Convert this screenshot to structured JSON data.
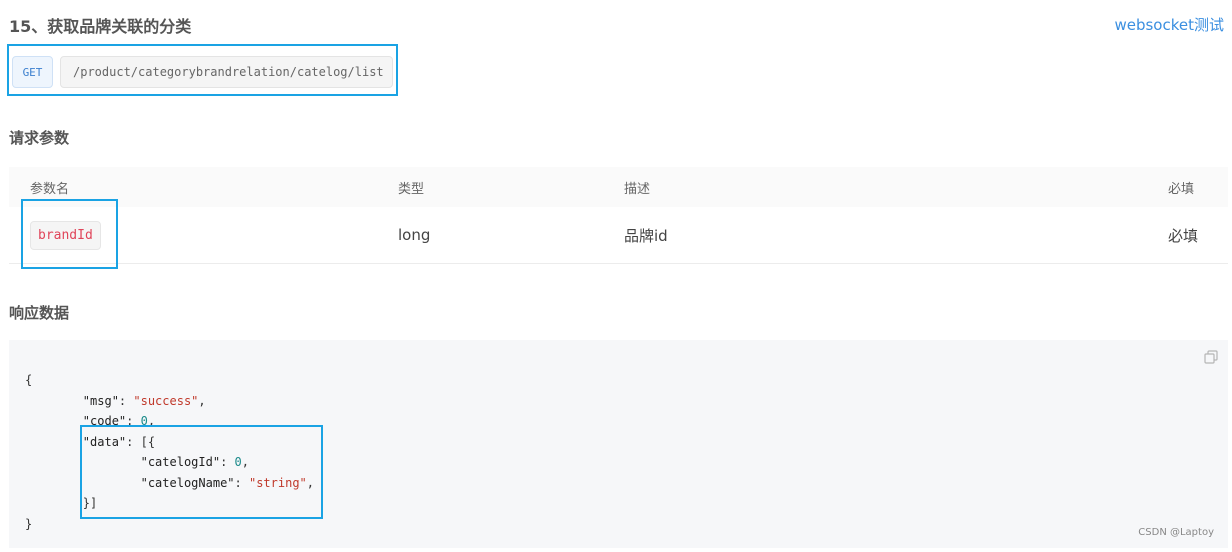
{
  "header": {
    "title": "15、获取品牌关联的分类",
    "websocket_link": "websocket测试"
  },
  "endpoint": {
    "method": "GET",
    "path": "/product/categorybrandrelation/catelog/list"
  },
  "request_params": {
    "section_title": "请求参数",
    "columns": [
      "参数名",
      "类型",
      "描述",
      "必填"
    ],
    "rows": [
      {
        "name": "brandId",
        "type": "long",
        "desc": "品牌id",
        "required": "必填"
      }
    ]
  },
  "response": {
    "section_title": "响应数据",
    "lines": {
      "open": "{",
      "msg_key": "\"msg\"",
      "msg_val": "\"success\"",
      "code_key": "\"code\"",
      "code_val": "0",
      "data_key": "\"data\"",
      "data_open": "[{",
      "catelogId_key": "\"catelogId\"",
      "catelogId_val": "0",
      "catelogName_key": "\"catelogName\"",
      "catelogName_val": "\"string\"",
      "data_close": "}]",
      "close": "}"
    }
  },
  "icons": {
    "copy": "copy-icon"
  },
  "colors": {
    "highlight": "#1aa3e4",
    "link": "#3b8fe0",
    "param": "#e0455a",
    "string": "#c0392b",
    "number": "#1a8a8a"
  },
  "watermark": "CSDN @Laptoy"
}
